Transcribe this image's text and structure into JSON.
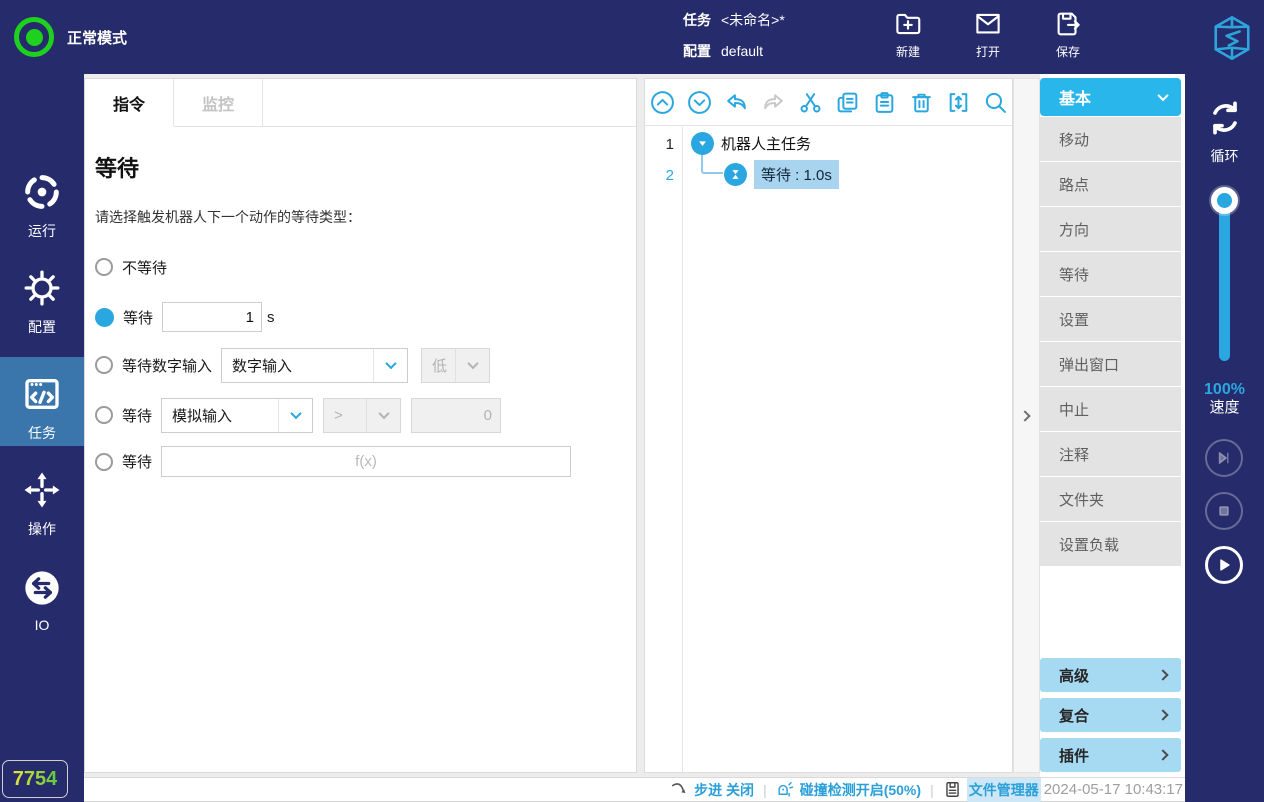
{
  "topbar": {
    "mode": "正常模式",
    "task_label": "任务",
    "task_value": "<未命名>*",
    "config_label": "配置",
    "config_value": "default",
    "actions": {
      "new": "新建",
      "open": "打开",
      "save": "保存"
    }
  },
  "left_sidebar": {
    "items": [
      {
        "label": "运行"
      },
      {
        "label": "配置"
      },
      {
        "label": "任务",
        "active": true
      },
      {
        "label": "操作"
      },
      {
        "label": "IO"
      }
    ],
    "badge": "7754"
  },
  "main": {
    "tabs": [
      {
        "label": "指令",
        "active": true
      },
      {
        "label": "监控",
        "active": false
      }
    ],
    "title": "等待",
    "description": "请选择触发机器人下一个动作的等待类型：",
    "options": {
      "no_wait": "不等待",
      "wait": "等待",
      "wait_seconds_value": "1",
      "wait_seconds_unit": "s",
      "wait_digital": "等待数字输入",
      "digital_select": "数字输入",
      "level_select": "低",
      "wait_analog": "等待",
      "analog_select": "模拟输入",
      "comparator": ">",
      "threshold_value": "0",
      "wait_expr": "等待",
      "expr_placeholder": "f(x)"
    }
  },
  "tree": {
    "rows": [
      {
        "num": "1",
        "label": "机器人主任务"
      },
      {
        "num": "2",
        "label": "等待 : 1.0s",
        "selected": true
      }
    ]
  },
  "palette": {
    "header": "基本",
    "items": [
      "移动",
      "路点",
      "方向",
      "等待",
      "设置",
      "弹出窗口",
      "中止",
      "注释",
      "文件夹",
      "设置负载"
    ],
    "groups": [
      "高级",
      "复合",
      "插件"
    ]
  },
  "right_sidebar": {
    "loop_label": "循环",
    "speed_value": "100%",
    "speed_label": "速度"
  },
  "statusbar": {
    "step": "步进 关闭",
    "collision": "碰撞检测开启(50%)",
    "file_manager": "文件管理器",
    "datetime": "2024-05-17 10:43:17"
  },
  "icons": {
    "toolbar": [
      "collapse-all",
      "expand-all",
      "undo",
      "redo",
      "cut",
      "copy",
      "paste",
      "delete",
      "insert",
      "search"
    ],
    "colors": {
      "accent": "#2aa7e0",
      "navy": "#262b6b",
      "header_cyan": "#29b6ea",
      "selection": "#a9d4ef",
      "group_blue": "#a6d9f2",
      "status_green": "#1fd11f",
      "status_blue": "#2a9fd8"
    }
  }
}
